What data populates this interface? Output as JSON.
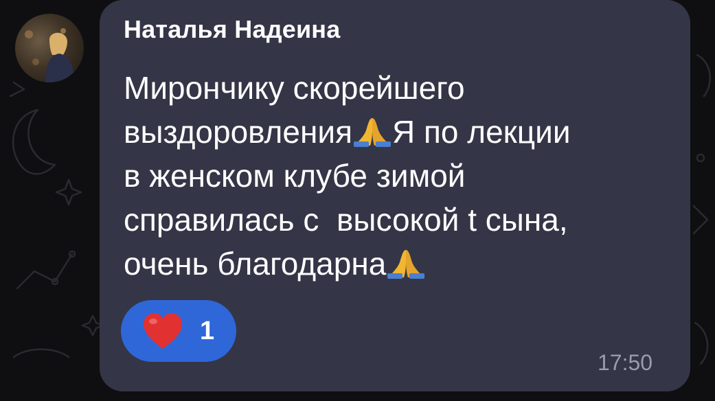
{
  "message": {
    "sender_name": "Наталья Надеина",
    "lines": [
      "Мирончику скорейшего",
      "выздоровления",
      "Я по лекции",
      "в женском клубе зимой",
      "справилась с  высокой t сына,",
      "очень благодарна"
    ],
    "emoji": "folded-hands",
    "time": "17:50"
  },
  "reaction": {
    "icon": "heart-icon",
    "count": "1",
    "accent": "#2f67d9"
  },
  "colors": {
    "bubble": "#343647",
    "background": "#0f0f12",
    "time": "#9a9cab"
  }
}
